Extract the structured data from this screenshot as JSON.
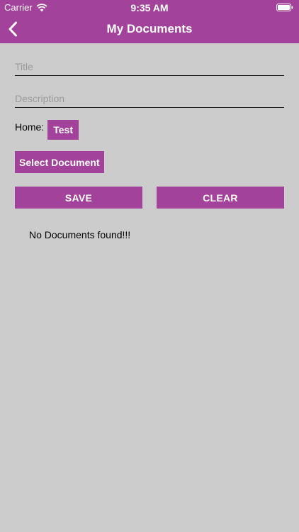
{
  "status_bar": {
    "carrier": "Carrier",
    "time": "9:35 AM",
    "wifi_icon": "wifi-icon",
    "battery_icon": "battery-icon"
  },
  "nav": {
    "title": "My Documents",
    "back_icon": "chevron-left-icon"
  },
  "form": {
    "title_placeholder": "Title",
    "title_value": "",
    "description_placeholder": "Description",
    "description_value": "",
    "home_label": "Home:",
    "home_value": "Test",
    "select_document_label": "Select Document",
    "save_label": "SAVE",
    "clear_label": "CLEAR"
  },
  "list": {
    "empty_message": "No Documents found!!!"
  },
  "colors": {
    "accent": "#a3429b",
    "background": "#cccccc"
  }
}
